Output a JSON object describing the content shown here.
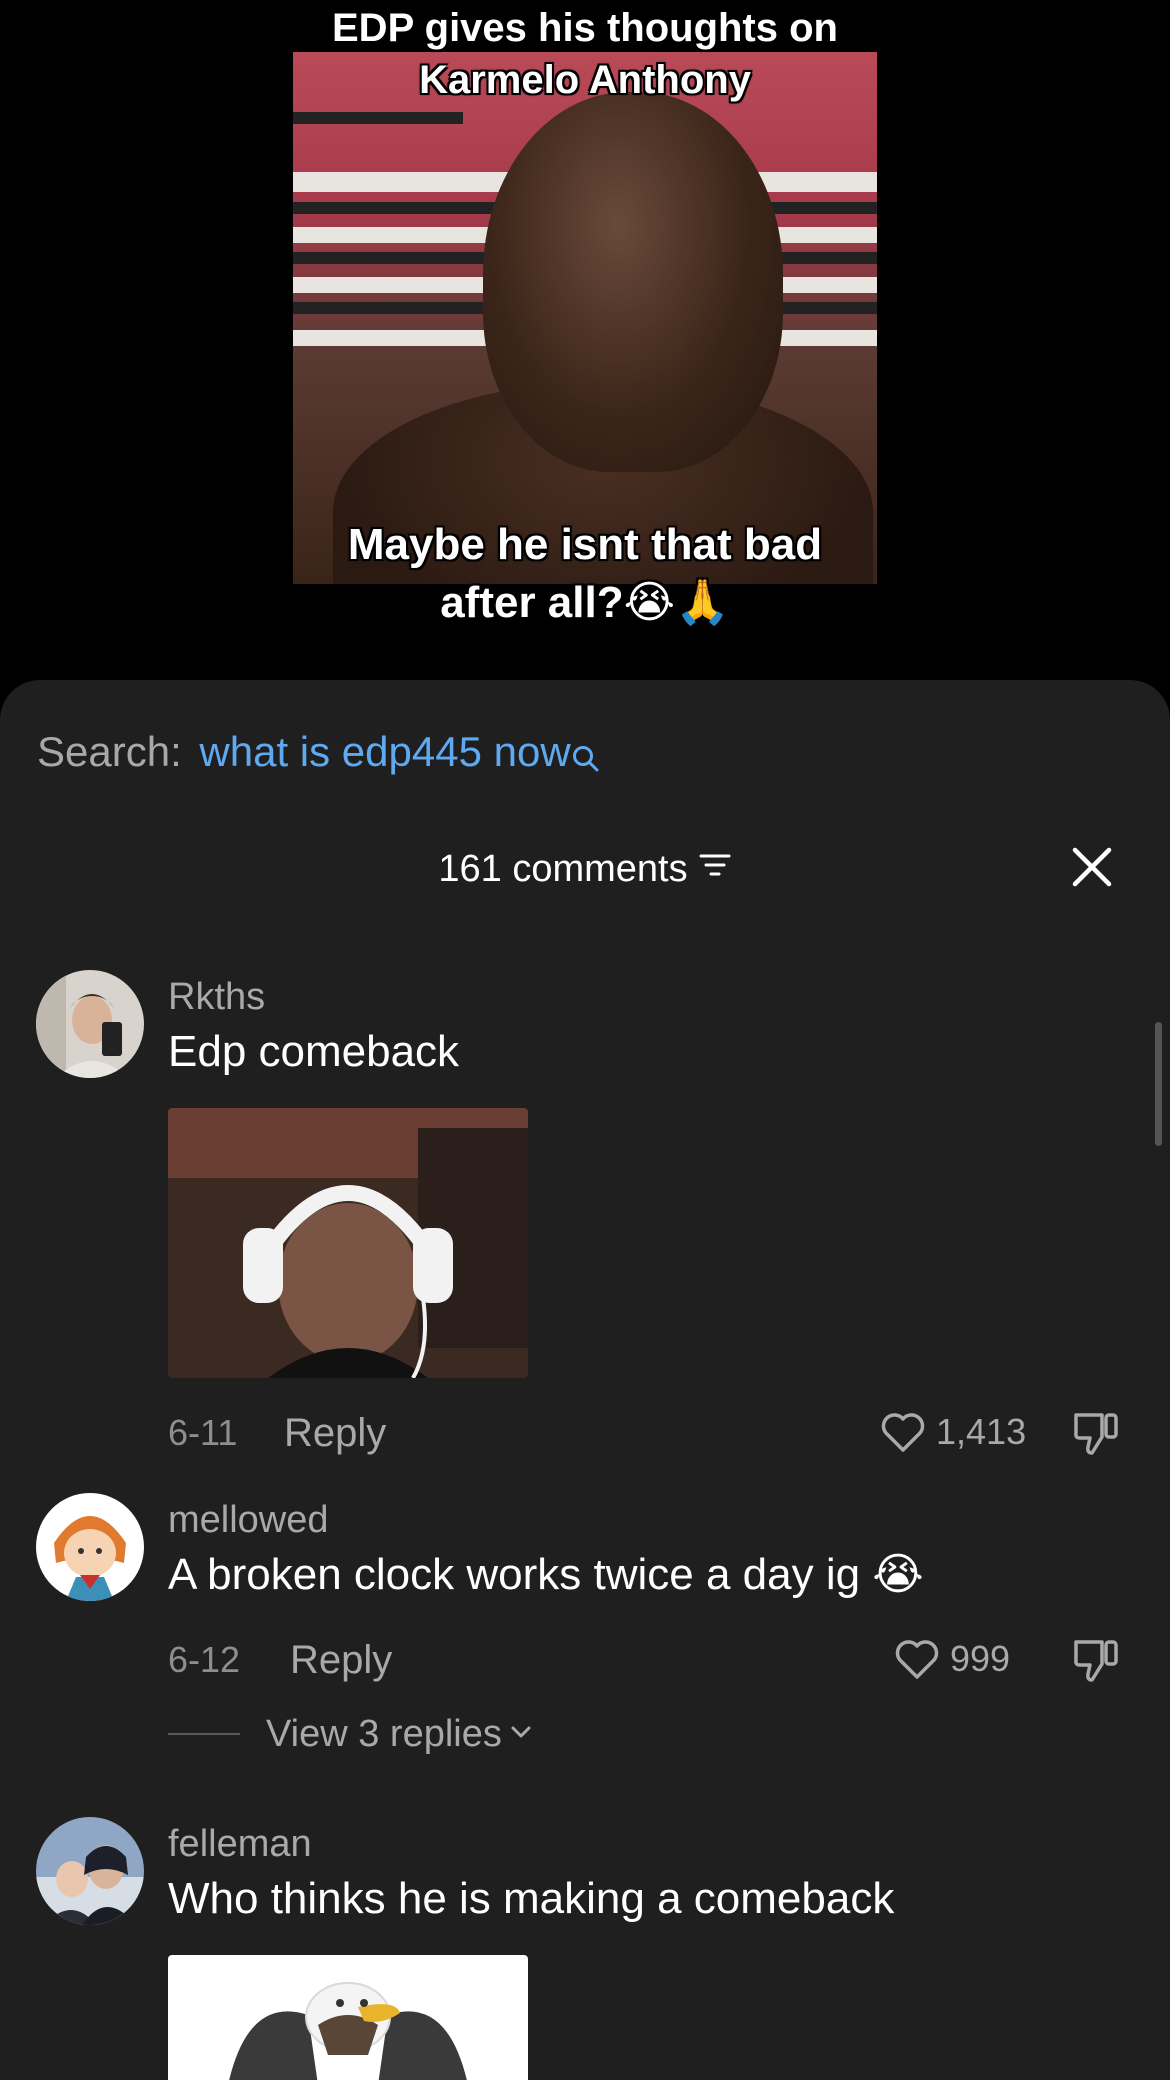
{
  "video": {
    "caption_top_line1": "EDP gives his thoughts on",
    "caption_top_line2": "Karmelo Anthony",
    "caption_bottom_line1": "Maybe he isnt that bad",
    "caption_bottom_line2": "after all?😭🙏"
  },
  "search": {
    "label": "Search:",
    "query": "what is edp445 now",
    "icon": "search-icon"
  },
  "header": {
    "comment_count": "161 comments",
    "sort_icon": "sort-icon",
    "close_icon": "close-icon"
  },
  "comments": [
    {
      "username": "Rkths",
      "text": "Edp comeback",
      "has_image": true,
      "image_desc": "gif",
      "date": "6-11",
      "reply_label": "Reply",
      "likes": "1,413"
    },
    {
      "username": "mellowed",
      "text": "A broken clock works twice a day ig 😭",
      "has_image": false,
      "date": "6-12",
      "reply_label": "Reply",
      "likes": "999",
      "view_replies": "View 3 replies"
    },
    {
      "username": "felleman",
      "text": "Who thinks he is making a comeback",
      "has_image": true
    }
  ],
  "colors": {
    "sheet_bg": "#1f1f1f",
    "search_query": "#5fa9f1",
    "muted_text": "#a9a9a9"
  }
}
